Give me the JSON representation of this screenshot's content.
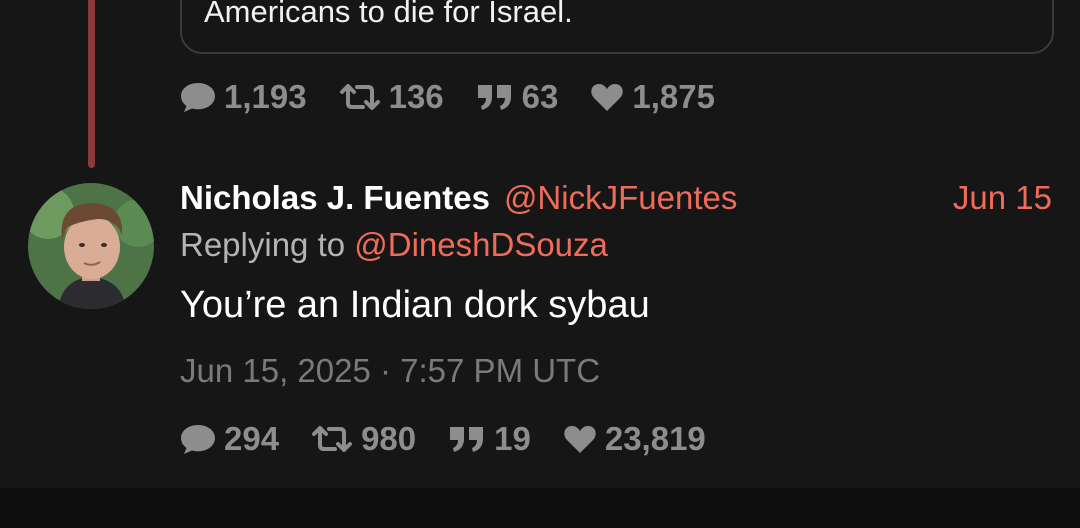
{
  "quoted_tweet": {
    "text": "Americans to die for Israel."
  },
  "parent_stats": {
    "replies": "1,193",
    "retweets": "136",
    "quotes": "63",
    "likes": "1,875"
  },
  "tweet": {
    "author_name": "Nicholas J. Fuentes",
    "author_handle": "@NickJFuentes",
    "date": "Jun 15",
    "replying_prefix": "Replying to ",
    "replying_to": "@DineshDSouza",
    "text": "You’re an Indian dork sybau",
    "timestamp": "Jun 15, 2025 · 7:57 PM UTC",
    "stats": {
      "replies": "294",
      "retweets": "980",
      "quotes": "19",
      "likes": "23,819"
    }
  },
  "colors": {
    "background": "#161616",
    "accent": "#ef6b5a",
    "thread_line": "#8a3a3a",
    "muted": "#8d8d8d"
  },
  "icons": {
    "reply": "comment-icon",
    "retweet": "retweet-icon",
    "quote": "quote-icon",
    "like": "heart-icon"
  }
}
